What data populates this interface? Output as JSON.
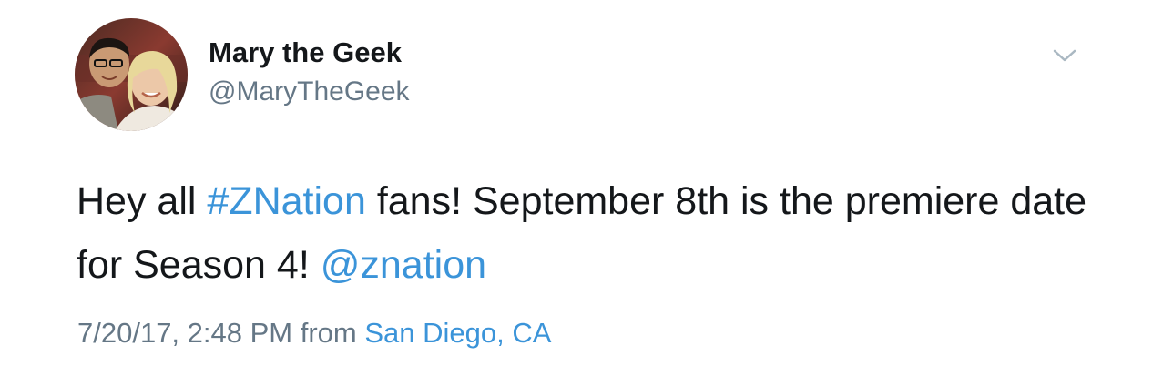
{
  "user": {
    "display_name": "Mary the Geek",
    "handle": "@MaryTheGeek"
  },
  "icons": {
    "menu": "chevron-down-icon"
  },
  "tweet": {
    "text_1": "Hey all ",
    "hashtag": "#ZNation",
    "text_2": " fans! September 8th is the premiere date for Season 4! ",
    "mention": "@znation"
  },
  "meta": {
    "timestamp": "7/20/17, 2:48 PM",
    "from_label": " from ",
    "location": "San Diego, CA"
  },
  "colors": {
    "link": "#3b94d9",
    "secondary_text": "#657786",
    "primary_text": "#14171a"
  }
}
